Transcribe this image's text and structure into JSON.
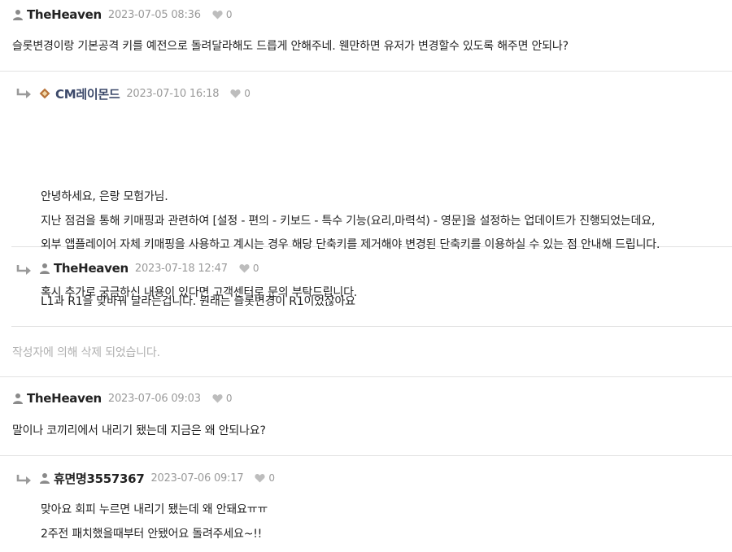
{
  "comments": [
    {
      "author": "TheHeaven",
      "date": "2023-07-05 08:36",
      "likes": "0",
      "body": "슬롯변경이랑 기본공격 키를 예전으로 돌려달라해도 드릅게 안해주네. 웬만하면 유저가 변경할수 있도록 해주면 안되나?"
    },
    {
      "author": "CM레이몬드",
      "date": "2023-07-10 16:18",
      "likes": "0",
      "lines": [
        "안녕하세요, 은랑 모험가님.",
        "지난 점검을 통해 키매핑과 관련하여 [설정 - 편의 - 키보드 - 특수 기능(요리,마력석) - 영문]을 설정하는 업데이트가 진행되었는데요,",
        "외부 앱플레이어 자체 키매핑을 사용하고 계시는 경우 해당 단축키를 제거해야 변경된 단축키를 이용하실 수 있는 점 안내해 드립니다.",
        "혹시 추가로 궁금하신 내용이 있다면 고객센터로 문의 부탁드립니다."
      ]
    },
    {
      "author": "TheHeaven",
      "date": "2023-07-18 12:47",
      "likes": "0",
      "body": "L1과 R1을 맞바꿔 달라는겁니다. 원래는 슬롯변경이 R1이었잖아요"
    },
    {
      "deleted_text": "작성자에 의해 삭제 되었습니다."
    },
    {
      "author": "TheHeaven",
      "date": "2023-07-06 09:03",
      "likes": "0",
      "body": "말이나 코끼리에서 내리기 됐는데 지금은 왜 안되나요?"
    },
    {
      "author": "휴면명3557367",
      "date": "2023-07-06 09:17",
      "likes": "0",
      "lines": [
        "맞아요 회피 누르면 내리기 됐는데 왜 안돼요ㅠㅠ",
        "2주전 패치했을때부터 안됐어요 돌려주세요~!!"
      ]
    }
  ]
}
